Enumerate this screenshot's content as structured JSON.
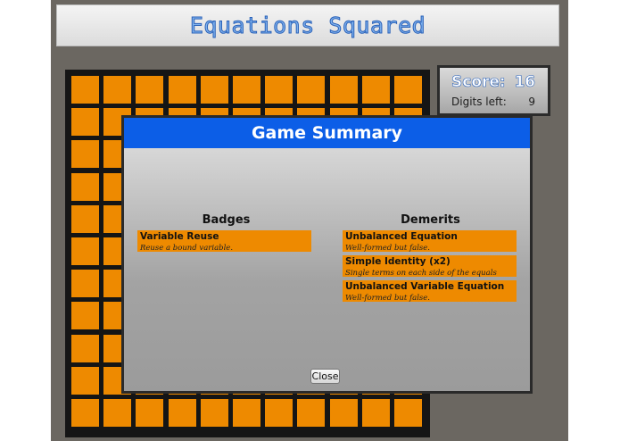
{
  "title": "Equations Squared",
  "scoreboard": {
    "score_label": "Score:",
    "score_value": "16",
    "digits_label": "Digits left:",
    "digits_value": "9"
  },
  "board": {
    "rows": 11,
    "cols": 11,
    "tile_color": "#ee8a00"
  },
  "dialog": {
    "title": "Game Summary",
    "badges_heading": "Badges",
    "demerits_heading": "Demerits",
    "badges": [
      {
        "name": "Variable Reuse",
        "description": "Reuse a bound variable."
      }
    ],
    "demerits": [
      {
        "name": "Unbalanced Equation",
        "description": "Well-formed but false."
      },
      {
        "name": "Simple Identity (x2)",
        "description": "Single terms on each side of the equals"
      },
      {
        "name": "Unbalanced Variable Equation",
        "description": "Well-formed but false."
      }
    ],
    "close_label": "Close"
  },
  "colors": {
    "header_blue": "#0c5ee7",
    "title_blue": "#7fb2ee",
    "tile_orange": "#ee8a00"
  }
}
